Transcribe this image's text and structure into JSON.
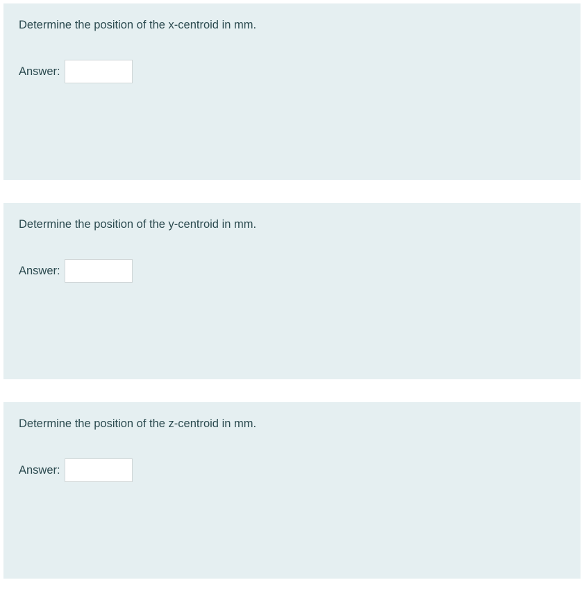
{
  "questions": [
    {
      "prompt": "Determine the position of the x-centroid in mm.",
      "answer_label": "Answer:",
      "answer_value": ""
    },
    {
      "prompt": "Determine the position of the y-centroid in mm.",
      "answer_label": "Answer:",
      "answer_value": ""
    },
    {
      "prompt": "Determine the position of the z-centroid in mm.",
      "answer_label": "Answer:",
      "answer_value": ""
    }
  ]
}
